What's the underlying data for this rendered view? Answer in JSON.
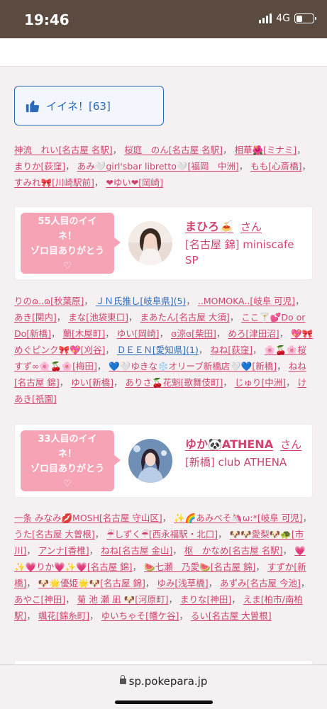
{
  "status": {
    "time": "19:46",
    "network": "4G"
  },
  "like_button": {
    "label": "イイネ！[63]"
  },
  "liked_by_top": [
    {
      "text": "神流　れい[名古屋 名駅]"
    },
    {
      "text": "桜庭　のん[名古屋 名駅]"
    },
    {
      "text": "相華🌺[ミナミ]"
    },
    {
      "text": "まりか[荻窪]"
    },
    {
      "text": "あみ🤍girl'sbar libretto🤍[福岡　中洲]"
    },
    {
      "text": "もも[心斎橋]"
    },
    {
      "text": "すみれ🎀[川崎駅前]"
    },
    {
      "text": "❤ゆい❤[岡崎]"
    }
  ],
  "cards": [
    {
      "bubble_line1": "55人目のイイ",
      "bubble_line2": "ネ！",
      "bubble_line3": "ゾロ目ありがとう",
      "bubble_heart": "♡",
      "name": "まひろ🍝",
      "san": "さん",
      "shop": "[名古屋 錦] miniscafe SP"
    },
    {
      "bubble_line1": "33人目のイイ",
      "bubble_line2": "ネ！",
      "bubble_line3": "ゾロ目ありがとう",
      "bubble_heart": "♡",
      "name": "ゆか🐼ATHENA",
      "san": "さん",
      "shop": "[新橋] club ATHENA"
    }
  ],
  "liked_by_middle": [
    {
      "text": "りのɷ..ɷ[秋葉原]"
    },
    {
      "text": "ＪＮ氏推し[岐阜県](5)",
      "blue": true
    },
    {
      "text": "..MOMOKA..[岐阜 可児]"
    },
    {
      "text": "あき[関内]"
    },
    {
      "text": "まな[池袋東口]"
    },
    {
      "text": "まあたん[名古屋 大須]"
    },
    {
      "text": "ここ🍸💕Do or Do[新橋]"
    },
    {
      "text": "蘭[木屋町]"
    },
    {
      "text": "ゆい[岡崎]"
    },
    {
      "text": "ɞ涼ɞ[柴田]"
    },
    {
      "text": "めろ[津田沼]"
    },
    {
      "text": "💖🎀めぐピンク🎀💖[刈谷]"
    },
    {
      "text": "ＤＥＥＮ[愛知県](1)",
      "blue": true
    },
    {
      "text": "ねね[荻窪]"
    },
    {
      "text": "🌸🍒🌸桜 すず∞🌸🍒🌸[梅田]"
    },
    {
      "text": "💙🤍ゆきな❄️オリーブ新橋店🤍💙[新橋]"
    },
    {
      "text": "ねね[名古屋 錦]"
    },
    {
      "text": "ゆい[新橋]"
    },
    {
      "text": "ありさ🍒花魁[歌舞伎町]"
    },
    {
      "text": "じゅり[中洲]"
    },
    {
      "text": "けあき[祇園]"
    }
  ],
  "liked_by_bottom": [
    {
      "text": "一条 みなみ💋MOSH[名古屋 守山区]"
    },
    {
      "text": "✨🌈あみべそ🦄ω:*[岐阜 可児]"
    },
    {
      "text": "うた[名古屋 大曽根]"
    },
    {
      "text": "☔しずく☔[西永福駅・北口]"
    },
    {
      "text": "🐶🐶愛梨🐶🐢[市川]"
    },
    {
      "text": "アンナ[香椎]"
    },
    {
      "text": "ねね[名古屋 金山]"
    },
    {
      "text": "枢　かなめ[名古屋 名駅]"
    },
    {
      "text": "💗✨💗りか💗✨💗[名古屋 錦]"
    },
    {
      "text": "🍉七瀬　乃愛🍉[名古屋 錦]"
    },
    {
      "text": "すずか[新橋]"
    },
    {
      "text": "🐶🌟優姫🌟🐶[名古屋 錦]"
    },
    {
      "text": "ゆみ[浅草橋]"
    },
    {
      "text": "あずみ[名古屋 今池]"
    },
    {
      "text": "あやこ[神田]"
    },
    {
      "text": "菊 池 瀬 凪 🐶[河原町]"
    },
    {
      "text": "まりな[神田]"
    },
    {
      "text": "えま[柏市/南柏駅]"
    },
    {
      "text": "颯花[錦糸町]"
    },
    {
      "text": "ゆいちゃそ[幡ケ谷]"
    },
    {
      "text": "るい[名古屋 大曽根]"
    }
  ],
  "browser": {
    "url": "sp.pokepara.jp"
  },
  "colors": {
    "accent_pink": "#d0436d",
    "bubble_pink": "#f7a3b6",
    "link_blue": "#2a6ab8",
    "statusbar": "#5b4a3f"
  }
}
